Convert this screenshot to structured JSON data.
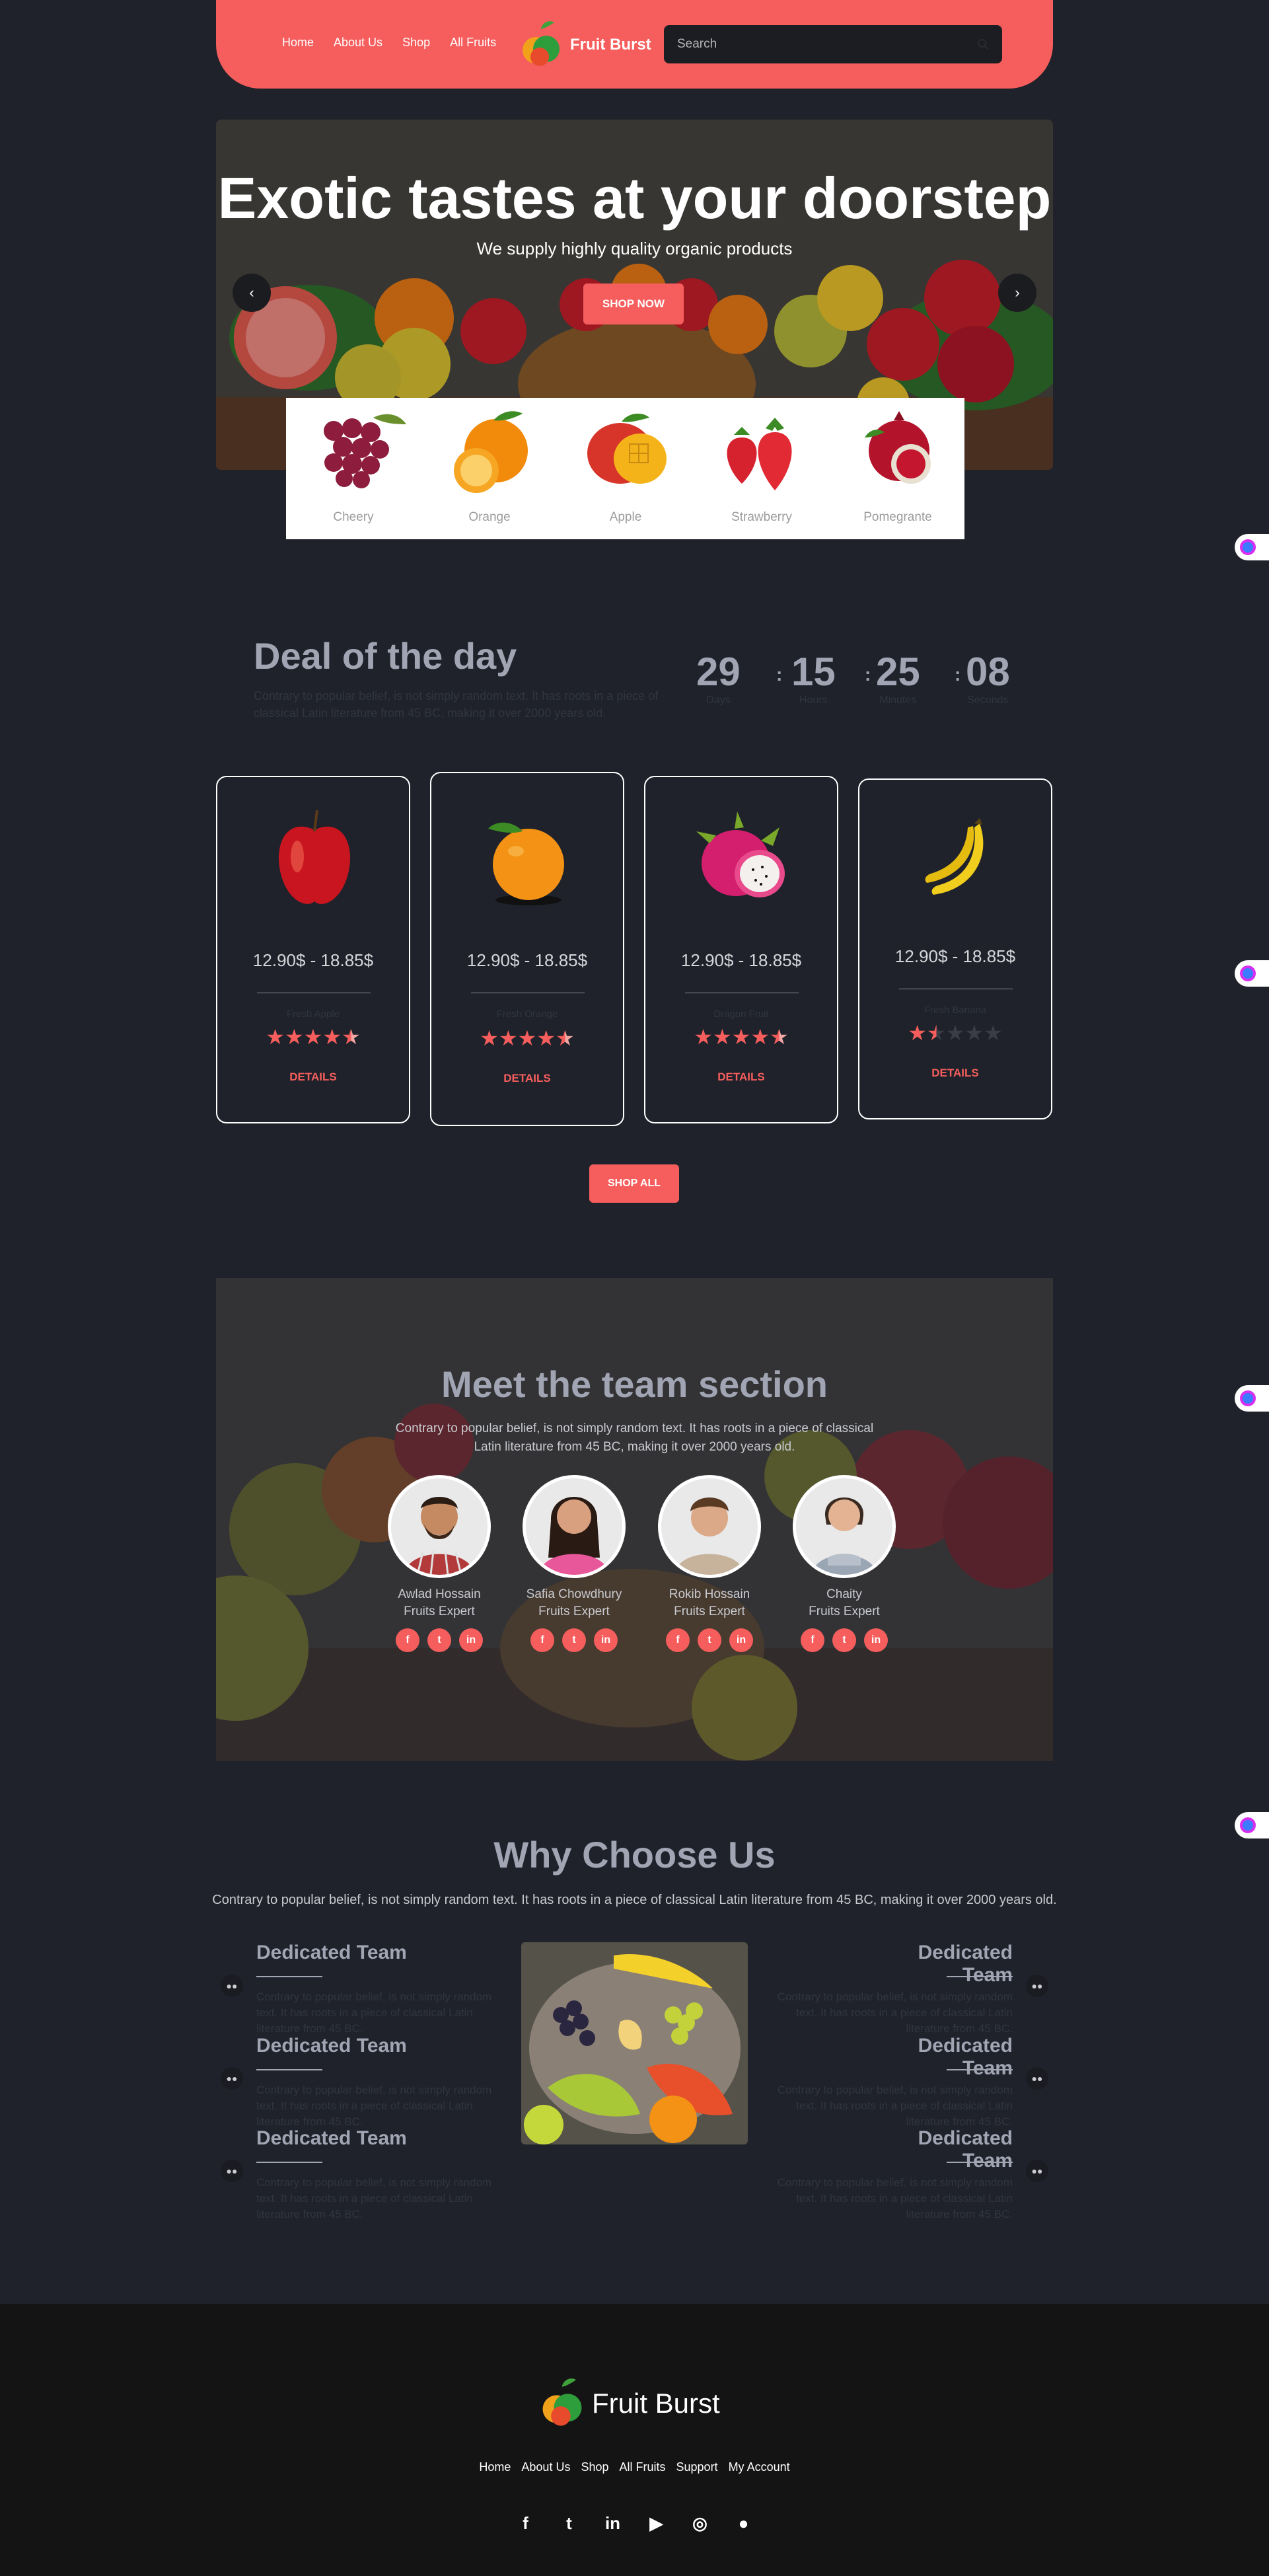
{
  "nav": {
    "links": [
      "Home",
      "About Us",
      "Shop",
      "All Fruits"
    ],
    "brand": "Fruit Burst",
    "search_placeholder": "Search",
    "icons": {
      "logo": "fruit-logo-icon",
      "search": "search-icon"
    }
  },
  "hero": {
    "title": "Exotic tastes at your doorstep",
    "subtitle": "We supply highly quality organic products",
    "button": "SHOP NOW",
    "prev": "‹",
    "next": "›"
  },
  "categories": [
    "Cheery",
    "Orange",
    "Apple",
    "Strawberry",
    "Pomegrante"
  ],
  "deal": {
    "title": "Deal of the day",
    "text": "Contrary to popular belief, is not simply random text. It has roots in a piece of classical Latin literature from 45 BC, making it over 2000 years old.",
    "countdown": [
      {
        "value": "29",
        "label": "Days"
      },
      {
        "value": "15",
        "label": "Hours"
      },
      {
        "value": "25",
        "label": "Minutes"
      },
      {
        "value": "08",
        "label": "Seconds"
      }
    ],
    "sep": ":",
    "cards": [
      {
        "fruit": "apple",
        "price": "12.90$ - 18.85$",
        "sub": "Fresh Apple",
        "rating": 4.5,
        "details": "DETAILS"
      },
      {
        "fruit": "orange",
        "price": "12.90$ - 18.85$",
        "sub": "Fresh Orange",
        "rating": 4.5,
        "details": "DETAILS"
      },
      {
        "fruit": "dragon-fruit",
        "price": "12.90$ - 18.85$",
        "sub": "Dragon Fruit",
        "rating": 4.5,
        "details": "DETAILS"
      },
      {
        "fruit": "banana",
        "price": "12.90$ - 18.85$",
        "sub": "Fresh Banana",
        "rating": 1.5,
        "details": "DETAILS"
      }
    ],
    "shop_all": "SHOP ALL"
  },
  "team": {
    "title": "Meet the team section",
    "text": "Contrary to popular belief, is not simply random text. It has roots in a piece of classical Latin literature from 45 BC, making it over 2000 years old.",
    "members": [
      {
        "name": "Awlad Hossain",
        "role": "Fruits Expert"
      },
      {
        "name": "Safia Chowdhury",
        "role": "Fruits Expert"
      },
      {
        "name": "Rokib Hossain",
        "role": "Fruits Expert"
      },
      {
        "name": "Chaity",
        "role": "Fruits Expert"
      }
    ],
    "social": [
      "f",
      "t",
      "in"
    ]
  },
  "why": {
    "title": "Why Choose Us",
    "text": "Contrary to popular belief, is not simply random text. It has roots in a piece of classical Latin literature from 45 BC, making it over 2000 years old.",
    "feature_title": "Dedicated Team",
    "feature_text": "Contrary to popular belief, is not simply random text. It has roots in a piece of classical Latin literature from 45 BC."
  },
  "footer": {
    "brand": "Fruit Burst",
    "links": [
      "Home",
      "About Us",
      "Shop",
      "All Fruits",
      "Support",
      "My Account"
    ],
    "social": [
      {
        "icon": "facebook-icon",
        "glyph": "f"
      },
      {
        "icon": "twitter-icon",
        "glyph": "t"
      },
      {
        "icon": "linkedin-icon",
        "glyph": "in"
      },
      {
        "icon": "youtube-icon",
        "glyph": "▶"
      },
      {
        "icon": "instagram-icon",
        "glyph": "◎"
      },
      {
        "icon": "apple-icon",
        "glyph": "●"
      }
    ]
  },
  "colors": {
    "accent": "#f65e5d",
    "background": "#1f222a",
    "muted": "#a1a5b3"
  }
}
